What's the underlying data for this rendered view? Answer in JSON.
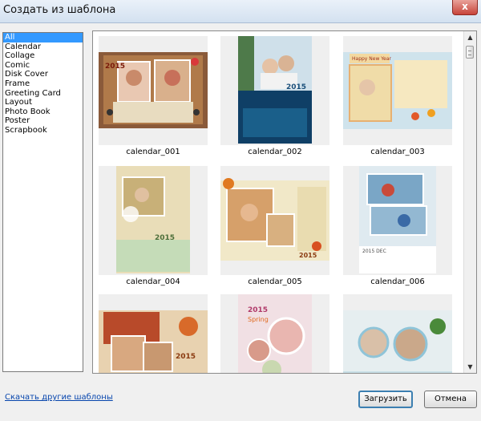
{
  "window": {
    "title": "Создать из шаблона",
    "close_glyph": "x"
  },
  "categories": [
    {
      "label": "All",
      "selected": true
    },
    {
      "label": "Calendar"
    },
    {
      "label": "Collage"
    },
    {
      "label": "Comic"
    },
    {
      "label": "Disk Cover"
    },
    {
      "label": "Frame"
    },
    {
      "label": "Greeting Card"
    },
    {
      "label": "Layout"
    },
    {
      "label": "Photo Book"
    },
    {
      "label": "Poster"
    },
    {
      "label": "Scrapbook"
    }
  ],
  "templates": [
    {
      "name": "calendar_001",
      "year": "2015"
    },
    {
      "name": "calendar_002",
      "year": "2015"
    },
    {
      "name": "calendar_003",
      "text": "Happy New Year"
    },
    {
      "name": "calendar_004",
      "year": "2015"
    },
    {
      "name": "calendar_005",
      "year": "2015"
    },
    {
      "name": "calendar_006",
      "text": "2015 DEC"
    },
    {
      "name": "",
      "year": "2015"
    },
    {
      "name": "",
      "year": "2015",
      "text": "Spring"
    },
    {
      "name": ""
    }
  ],
  "footer": {
    "download_link": "Скачать другие шаблоны",
    "load_button": "Загрузить",
    "cancel_button": "Отмена"
  },
  "colors": {
    "selection": "#3399ff",
    "link": "#0645ad"
  }
}
